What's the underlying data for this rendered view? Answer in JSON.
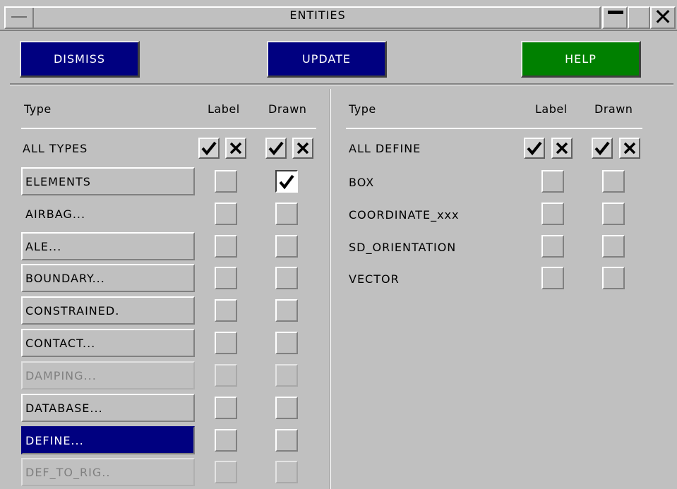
{
  "window": {
    "title": "ENTITIES"
  },
  "actions": {
    "dismiss": "DISMISS",
    "update": "UPDATE",
    "help": "HELP"
  },
  "headers": {
    "left": {
      "type": "Type",
      "label": "Label",
      "drawn": "Drawn"
    },
    "right": {
      "type": "Type",
      "label": "Label",
      "drawn": "Drawn"
    }
  },
  "left": {
    "all_types": "ALL TYPES",
    "rows": [
      {
        "label": "ELEMENTS",
        "style": "button",
        "drawn_checked": true
      },
      {
        "label": "AIRBAG...",
        "style": "plain",
        "drawn_checked": false
      },
      {
        "label": "ALE...",
        "style": "button",
        "drawn_checked": false
      },
      {
        "label": "BOUNDARY...",
        "style": "button",
        "drawn_checked": false
      },
      {
        "label": "CONSTRAINED.",
        "style": "button",
        "drawn_checked": false
      },
      {
        "label": "CONTACT...",
        "style": "button",
        "drawn_checked": false
      },
      {
        "label": "DAMPING...",
        "style": "dim",
        "drawn_checked": false
      },
      {
        "label": "DATABASE...",
        "style": "button",
        "drawn_checked": false
      },
      {
        "label": "DEFINE...",
        "style": "selected",
        "drawn_checked": false
      },
      {
        "label": "DEF_TO_RIG..",
        "style": "dim",
        "drawn_checked": false
      }
    ]
  },
  "right": {
    "all_define": "ALL DEFINE",
    "rows": [
      {
        "label": "BOX"
      },
      {
        "label": "COORDINATE_xxx"
      },
      {
        "label": "SD_ORIENTATION"
      },
      {
        "label": "VECTOR"
      }
    ]
  },
  "colors": {
    "dialog_bg": "#c0c0c0",
    "blue_button": "#000080",
    "green_button": "#008000"
  }
}
